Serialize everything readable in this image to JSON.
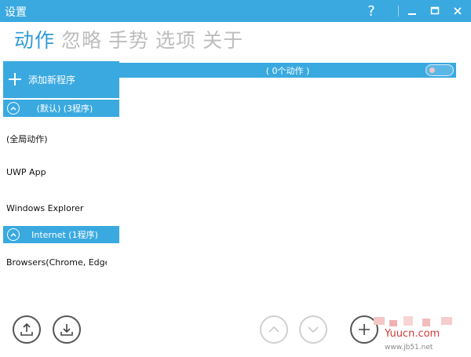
{
  "window": {
    "title": "设置",
    "help_label": "?"
  },
  "tabs": [
    {
      "label": "动作",
      "active": true
    },
    {
      "label": "忽略"
    },
    {
      "label": "手势"
    },
    {
      "label": "选项"
    },
    {
      "label": "关于"
    }
  ],
  "sidebar": {
    "add_label": "添加新程序",
    "groups": [
      {
        "label": "(默认) (3程序)"
      },
      {
        "label": "Internet (1程序)"
      }
    ],
    "items": [
      {
        "label": "(全局动作)"
      },
      {
        "label": "UWP App"
      },
      {
        "label": "Windows Explorer"
      },
      {
        "label": "Browsers(Chrome, Edge"
      }
    ]
  },
  "main": {
    "action_count": "( 0个动作 )"
  },
  "watermark": {
    "text": "Yuucn.com",
    "subtext": "www.jb51.net"
  },
  "colors": {
    "accent": "#3aa9e0",
    "tab_active": "#2f9bd6",
    "tab_inactive": "#bdbdbd"
  },
  "icons": [
    "help-icon",
    "minimize-icon",
    "maximize-icon",
    "close-icon",
    "plus-icon",
    "chevron-up-icon",
    "upload-icon",
    "download-icon",
    "arrow-up-icon",
    "arrow-down-icon"
  ]
}
